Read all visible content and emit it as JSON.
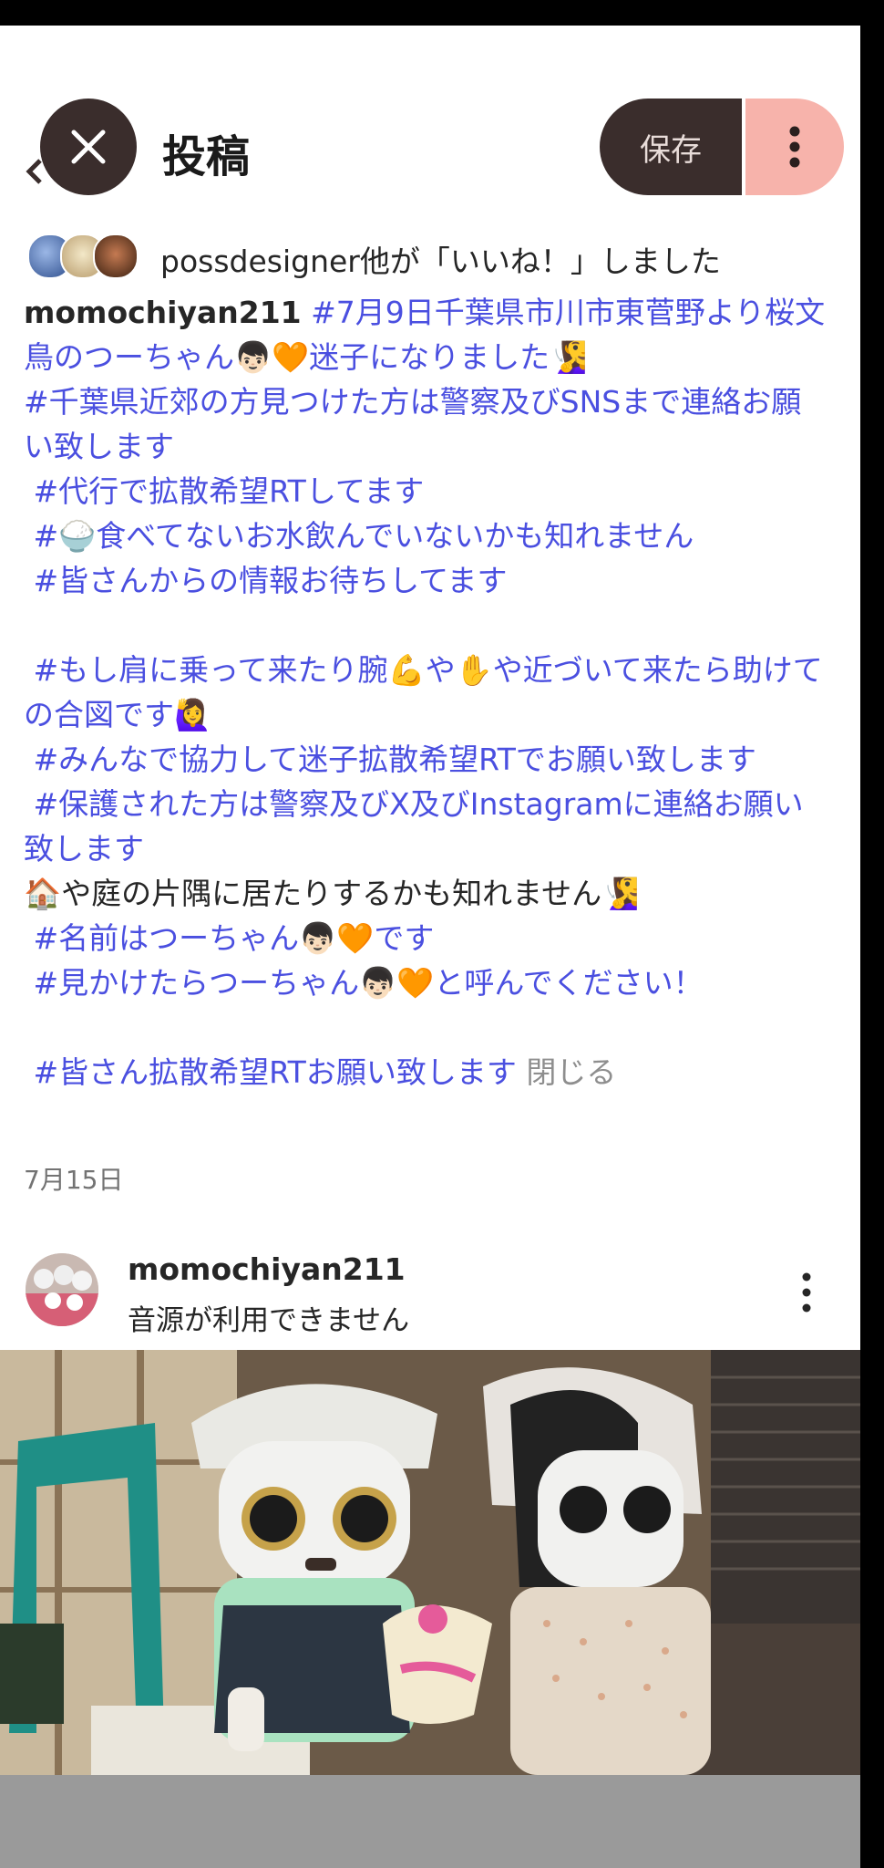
{
  "header": {
    "title": "投稿",
    "save_label": "保存"
  },
  "likes": {
    "text": "possdesigner他が「いいね！」しました"
  },
  "caption": {
    "username": "momochiyan211",
    "line1": " #7月9日千葉県市川市東菅野より桜文鳥のつーちゃん👦🏻🧡迷子になりました🧏‍♀️\n#千葉県近郊の方見つけた方は警察及びSNSまで連絡お願い致します\n #代行で拡散希望RTしてます\n #🍚食べてないお水飲んでいないかも知れません\n #皆さんからの情報お待ちしてます\n\n #もし肩に乗って来たり腕💪や✋や近づいて来たら助けての合図です🙋‍♀️\n #みんなで協力して迷子拡散希望RTでお願い致します\n #保護された方は警察及びX及びInstagramに連絡お願い致します\n",
    "line2_plain": "🏠や庭の片隅に居たりするかも知れません🧏‍♀️",
    "line3": "\n #名前はつーちゃん👦🏻🧡です\n #見かけたらつーちゃん👦🏻🧡と呼んでください！\n\n #皆さん拡散希望RTお願い致します ",
    "close_label": "閉じる"
  },
  "post": {
    "date": "7月15日",
    "username": "momochiyan211",
    "audio": "音源が利用できません"
  },
  "icons": {
    "close": "close-icon",
    "more": "more-vert-icon",
    "back": "chevron-left-icon"
  },
  "colors": {
    "hashtag": "#4a4fe0",
    "dark_button": "#3a2d2c",
    "pink_button": "#f7b3ab",
    "overlay": "#9a9a9a"
  }
}
